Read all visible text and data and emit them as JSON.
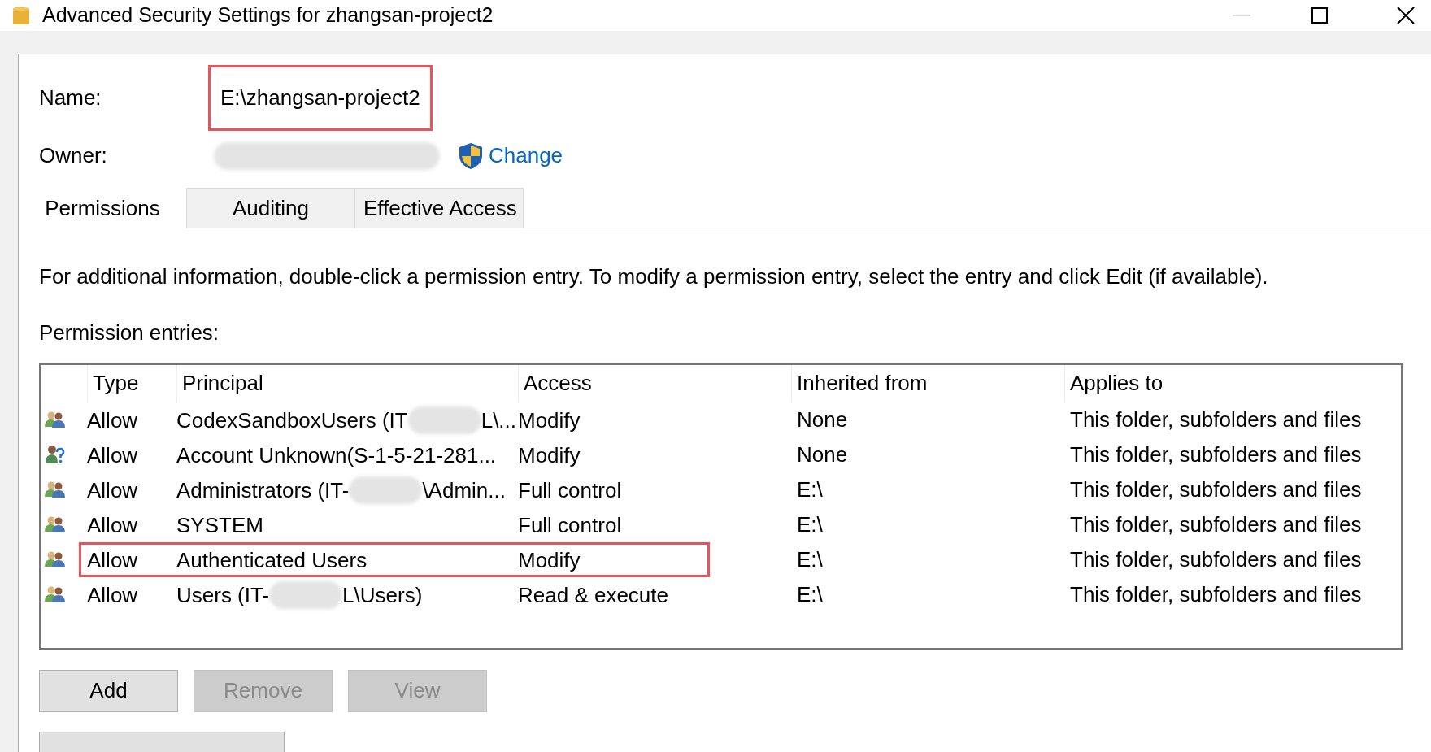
{
  "window": {
    "title": "Advanced Security Settings for zhangsan-project2"
  },
  "name": {
    "label": "Name:",
    "value": "E:\\zhangsan-project2",
    "highlighted": true
  },
  "owner": {
    "label": "Owner:",
    "redacted": true,
    "change_link": "Change"
  },
  "tabs": [
    {
      "label": "Permissions",
      "selected": true
    },
    {
      "label": "Auditing",
      "selected": false
    },
    {
      "label": "Effective Access",
      "selected": false
    }
  ],
  "info_text": "For additional information, double-click a permission entry. To modify a permission entry, select the entry and click Edit (if available).",
  "entries_label": "Permission entries:",
  "table": {
    "columns": [
      "Type",
      "Principal",
      "Access",
      "Inherited from",
      "Applies to"
    ],
    "rows": [
      {
        "kind": "group",
        "type": "Allow",
        "principal": {
          "prefix": "CodexSandboxUsers (IT",
          "redacted": true,
          "suffix": "L\\..."
        },
        "access": "Modify",
        "inherited_from": "None",
        "applies_to": "This folder, subfolders and files",
        "highlighted": false
      },
      {
        "kind": "unknown",
        "type": "Allow",
        "principal": {
          "prefix": "Account Unknown(S-1-5-21-281..."
        },
        "access": "Modify",
        "inherited_from": "None",
        "applies_to": "This folder, subfolders and files",
        "highlighted": false
      },
      {
        "kind": "group",
        "type": "Allow",
        "principal": {
          "prefix": "Administrators (IT-",
          "redacted": true,
          "suffix": "\\Admin..."
        },
        "access": "Full control",
        "inherited_from": "E:\\",
        "applies_to": "This folder, subfolders and files",
        "highlighted": false
      },
      {
        "kind": "group",
        "type": "Allow",
        "principal": {
          "prefix": "SYSTEM"
        },
        "access": "Full control",
        "inherited_from": "E:\\",
        "applies_to": "This folder, subfolders and files",
        "highlighted": false
      },
      {
        "kind": "group",
        "type": "Allow",
        "principal": {
          "prefix": "Authenticated Users"
        },
        "access": "Modify",
        "inherited_from": "E:\\",
        "applies_to": "This folder, subfolders and files",
        "highlighted": true
      },
      {
        "kind": "group",
        "type": "Allow",
        "principal": {
          "prefix": "Users (IT-",
          "redacted": true,
          "suffix": "L\\Users)"
        },
        "access": "Read & execute",
        "inherited_from": "E:\\",
        "applies_to": "This folder, subfolders and files",
        "highlighted": false
      }
    ]
  },
  "buttons": [
    {
      "label": "Add",
      "disabled": false
    },
    {
      "label": "Remove",
      "disabled": true
    },
    {
      "label": "View",
      "disabled": true
    }
  ]
}
